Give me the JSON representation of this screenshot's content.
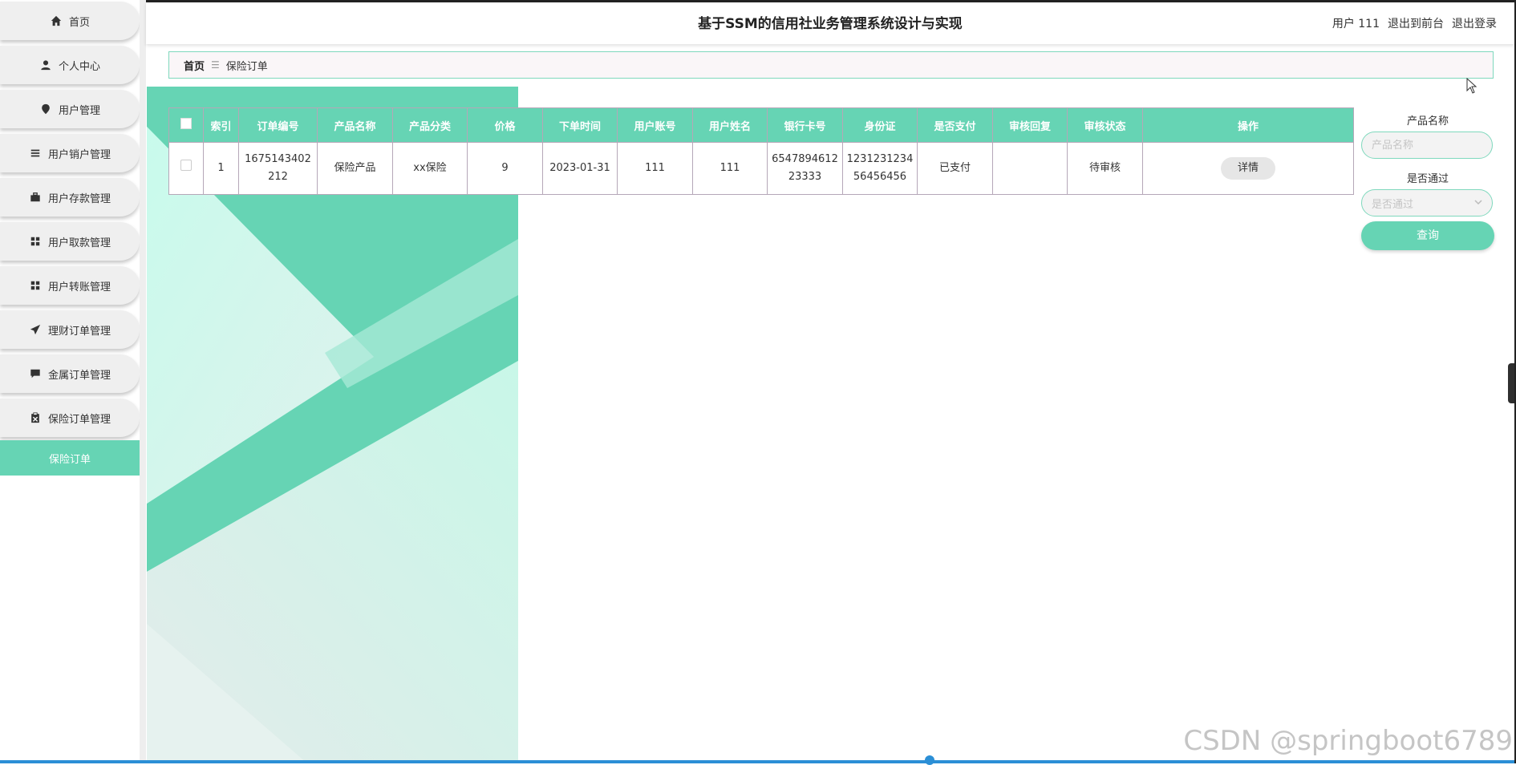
{
  "header": {
    "title": "基于SSM的信用社业务管理系统设计与实现",
    "user_label": "用户 111",
    "front_link": "退出到前台",
    "logout_link": "退出登录"
  },
  "sidebar": {
    "items": [
      {
        "label": "首页",
        "icon": "home-icon"
      },
      {
        "label": "个人中心",
        "icon": "user-icon"
      },
      {
        "label": "用户管理",
        "icon": "pin-icon"
      },
      {
        "label": "用户销户管理",
        "icon": "list-icon"
      },
      {
        "label": "用户存款管理",
        "icon": "briefcase-icon"
      },
      {
        "label": "用户取款管理",
        "icon": "grid-icon"
      },
      {
        "label": "用户转账管理",
        "icon": "grid-icon"
      },
      {
        "label": "理财订单管理",
        "icon": "send-icon"
      },
      {
        "label": "金属订单管理",
        "icon": "chat-icon"
      },
      {
        "label": "保险订单管理",
        "icon": "clipboard-icon"
      }
    ],
    "active_sub": "保险订单"
  },
  "breadcrumb": {
    "home": "首页",
    "separator": "☰",
    "current": "保险订单"
  },
  "table": {
    "columns": [
      "索引",
      "订单编号",
      "产品名称",
      "产品分类",
      "价格",
      "下单时间",
      "用户账号",
      "用户姓名",
      "银行卡号",
      "身份证",
      "是否支付",
      "审核回复",
      "审核状态",
      "操作"
    ],
    "rows": [
      {
        "index": "1",
        "order_no_line1": "1675143402",
        "order_no_line2": "212",
        "product_name": "保险产品",
        "category": "xx保险",
        "price": "9",
        "order_time": "2023-01-31",
        "account": "111",
        "username": "111",
        "card_line1": "6547894612",
        "card_line2": "23333",
        "id_line1": "1231231234",
        "id_line2": "56456456",
        "paid": "已支付",
        "reply": "",
        "status": "待审核",
        "action": "详情"
      }
    ]
  },
  "search": {
    "name_label": "产品名称",
    "name_placeholder": "产品名称",
    "pass_label": "是否通过",
    "pass_placeholder": "是否通过",
    "button": "查询"
  },
  "watermark": "CSDN @springboot6789",
  "colors": {
    "accent": "#66d4b4",
    "border": "#b5a7b8"
  }
}
